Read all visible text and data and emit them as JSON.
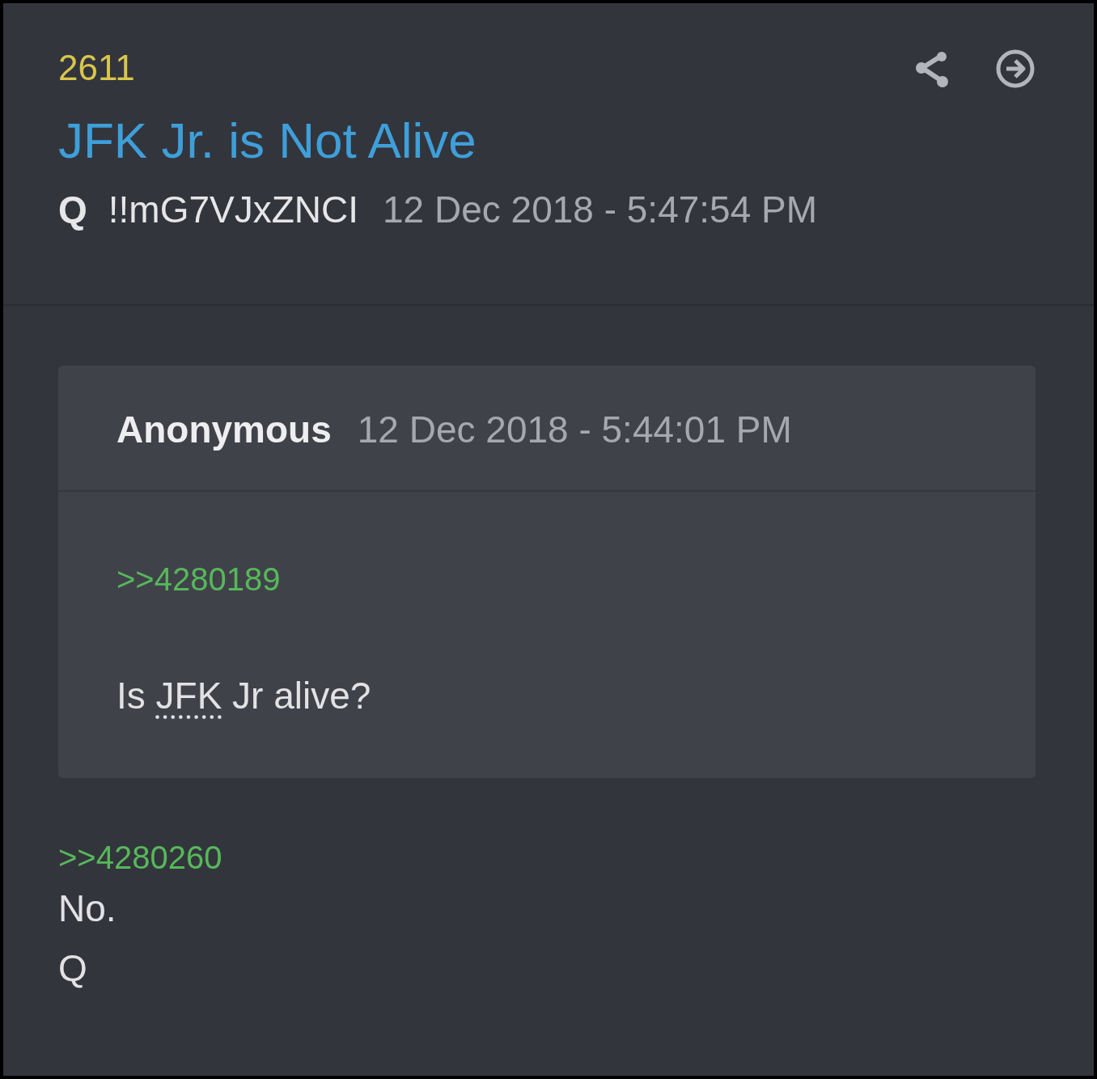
{
  "post": {
    "number": "2611",
    "title": "JFK Jr. is Not Alive",
    "author": "Q",
    "tripcode": "!!mG7VJxZNCI",
    "timestamp": "12 Dec 2018 - 5:47:54 PM",
    "quote": {
      "author": "Anonymous",
      "timestamp": "12 Dec 2018 - 5:44:01 PM",
      "reference": ">>4280189",
      "parts": [
        {
          "kind": "plain",
          "text": "Is "
        },
        {
          "kind": "abbr",
          "text": "JFK"
        },
        {
          "kind": "plain",
          "text": " Jr alive?"
        }
      ]
    },
    "reply_reference": ">>4280260",
    "lines": [
      "No.",
      "Q"
    ]
  }
}
